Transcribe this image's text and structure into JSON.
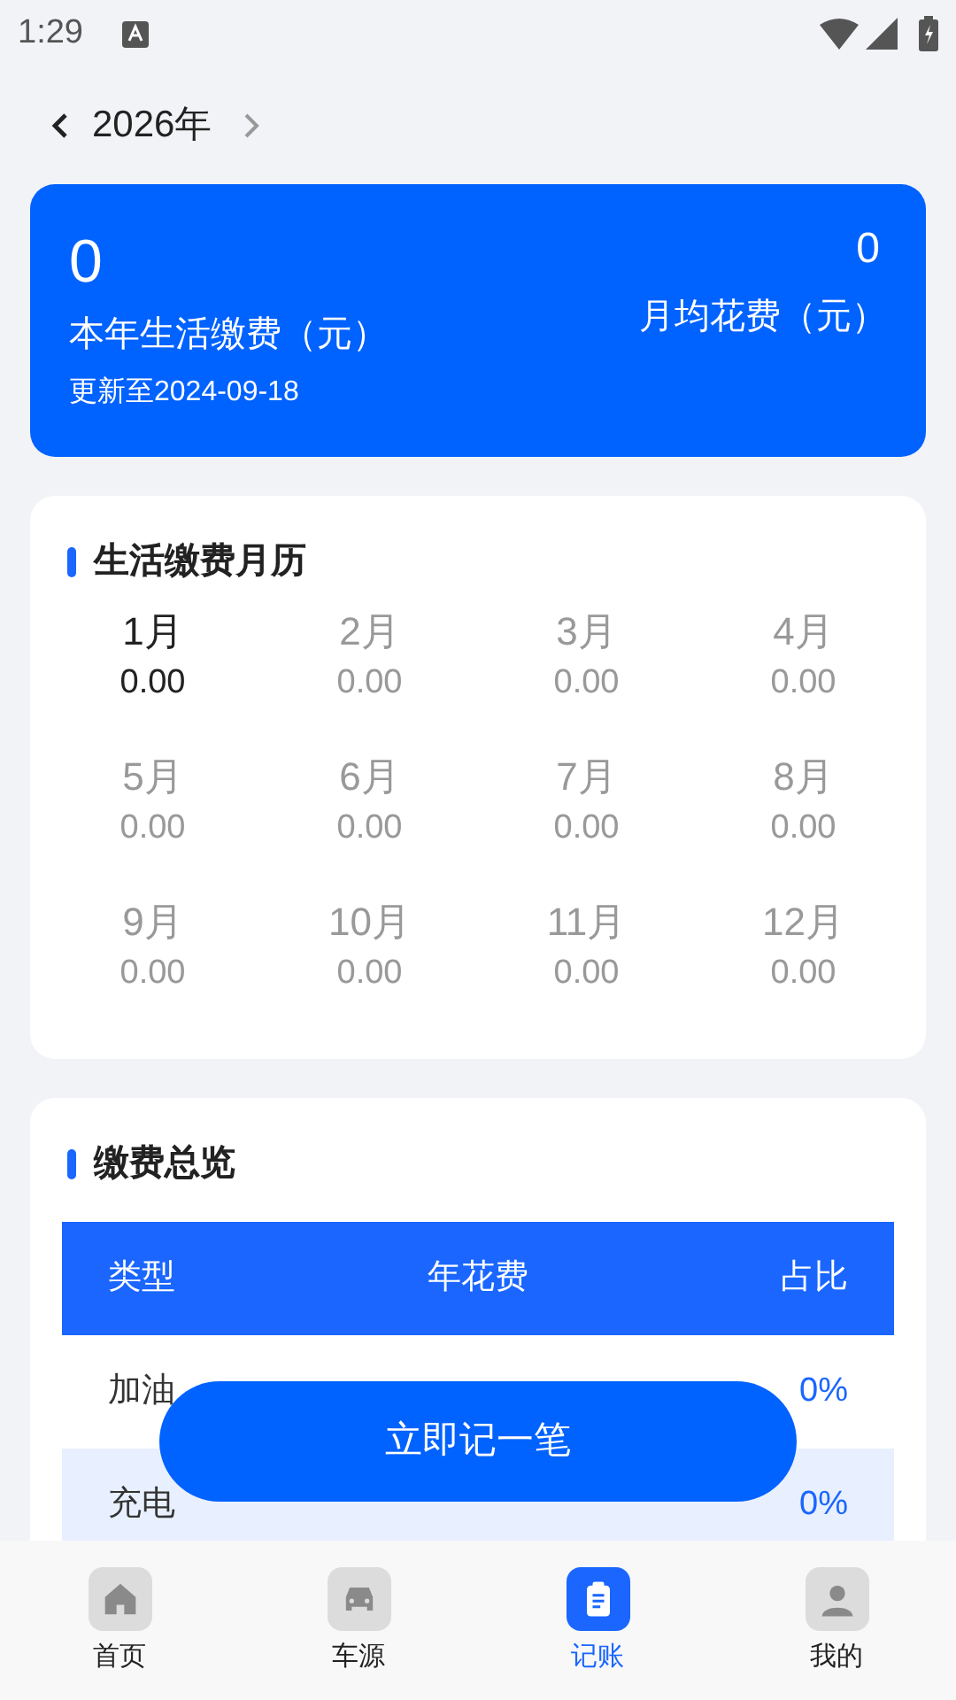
{
  "status_bar": {
    "time": "1:29"
  },
  "year_nav": {
    "year": "2026年"
  },
  "summary": {
    "total": "0",
    "total_label": "本年生活缴费（元）",
    "updated": "更新至2024-09-18",
    "monthly": "0",
    "monthly_label": "月均花费（元）"
  },
  "calendar": {
    "title": "生活缴费月历",
    "months": [
      {
        "label": "1月",
        "amount": "0.00",
        "selected": true
      },
      {
        "label": "2月",
        "amount": "0.00",
        "selected": false
      },
      {
        "label": "3月",
        "amount": "0.00",
        "selected": false
      },
      {
        "label": "4月",
        "amount": "0.00",
        "selected": false
      },
      {
        "label": "5月",
        "amount": "0.00",
        "selected": false
      },
      {
        "label": "6月",
        "amount": "0.00",
        "selected": false
      },
      {
        "label": "7月",
        "amount": "0.00",
        "selected": false
      },
      {
        "label": "8月",
        "amount": "0.00",
        "selected": false
      },
      {
        "label": "9月",
        "amount": "0.00",
        "selected": false
      },
      {
        "label": "10月",
        "amount": "0.00",
        "selected": false
      },
      {
        "label": "11月",
        "amount": "0.00",
        "selected": false
      },
      {
        "label": "12月",
        "amount": "0.00",
        "selected": false
      }
    ]
  },
  "overview": {
    "title": "缴费总览",
    "columns": [
      "类型",
      "年花费",
      "占比"
    ],
    "rows": [
      {
        "type": "加油",
        "share": "0%"
      },
      {
        "type": "充电",
        "share": "0%"
      }
    ]
  },
  "record_button": "立即记一笔",
  "bottom_nav": [
    {
      "label": "首页",
      "kind": "home",
      "selected": false
    },
    {
      "label": "车源",
      "kind": "car",
      "selected": false
    },
    {
      "label": "记账",
      "kind": "clipboard",
      "selected": true
    },
    {
      "label": "我的",
      "kind": "user",
      "selected": false
    }
  ]
}
